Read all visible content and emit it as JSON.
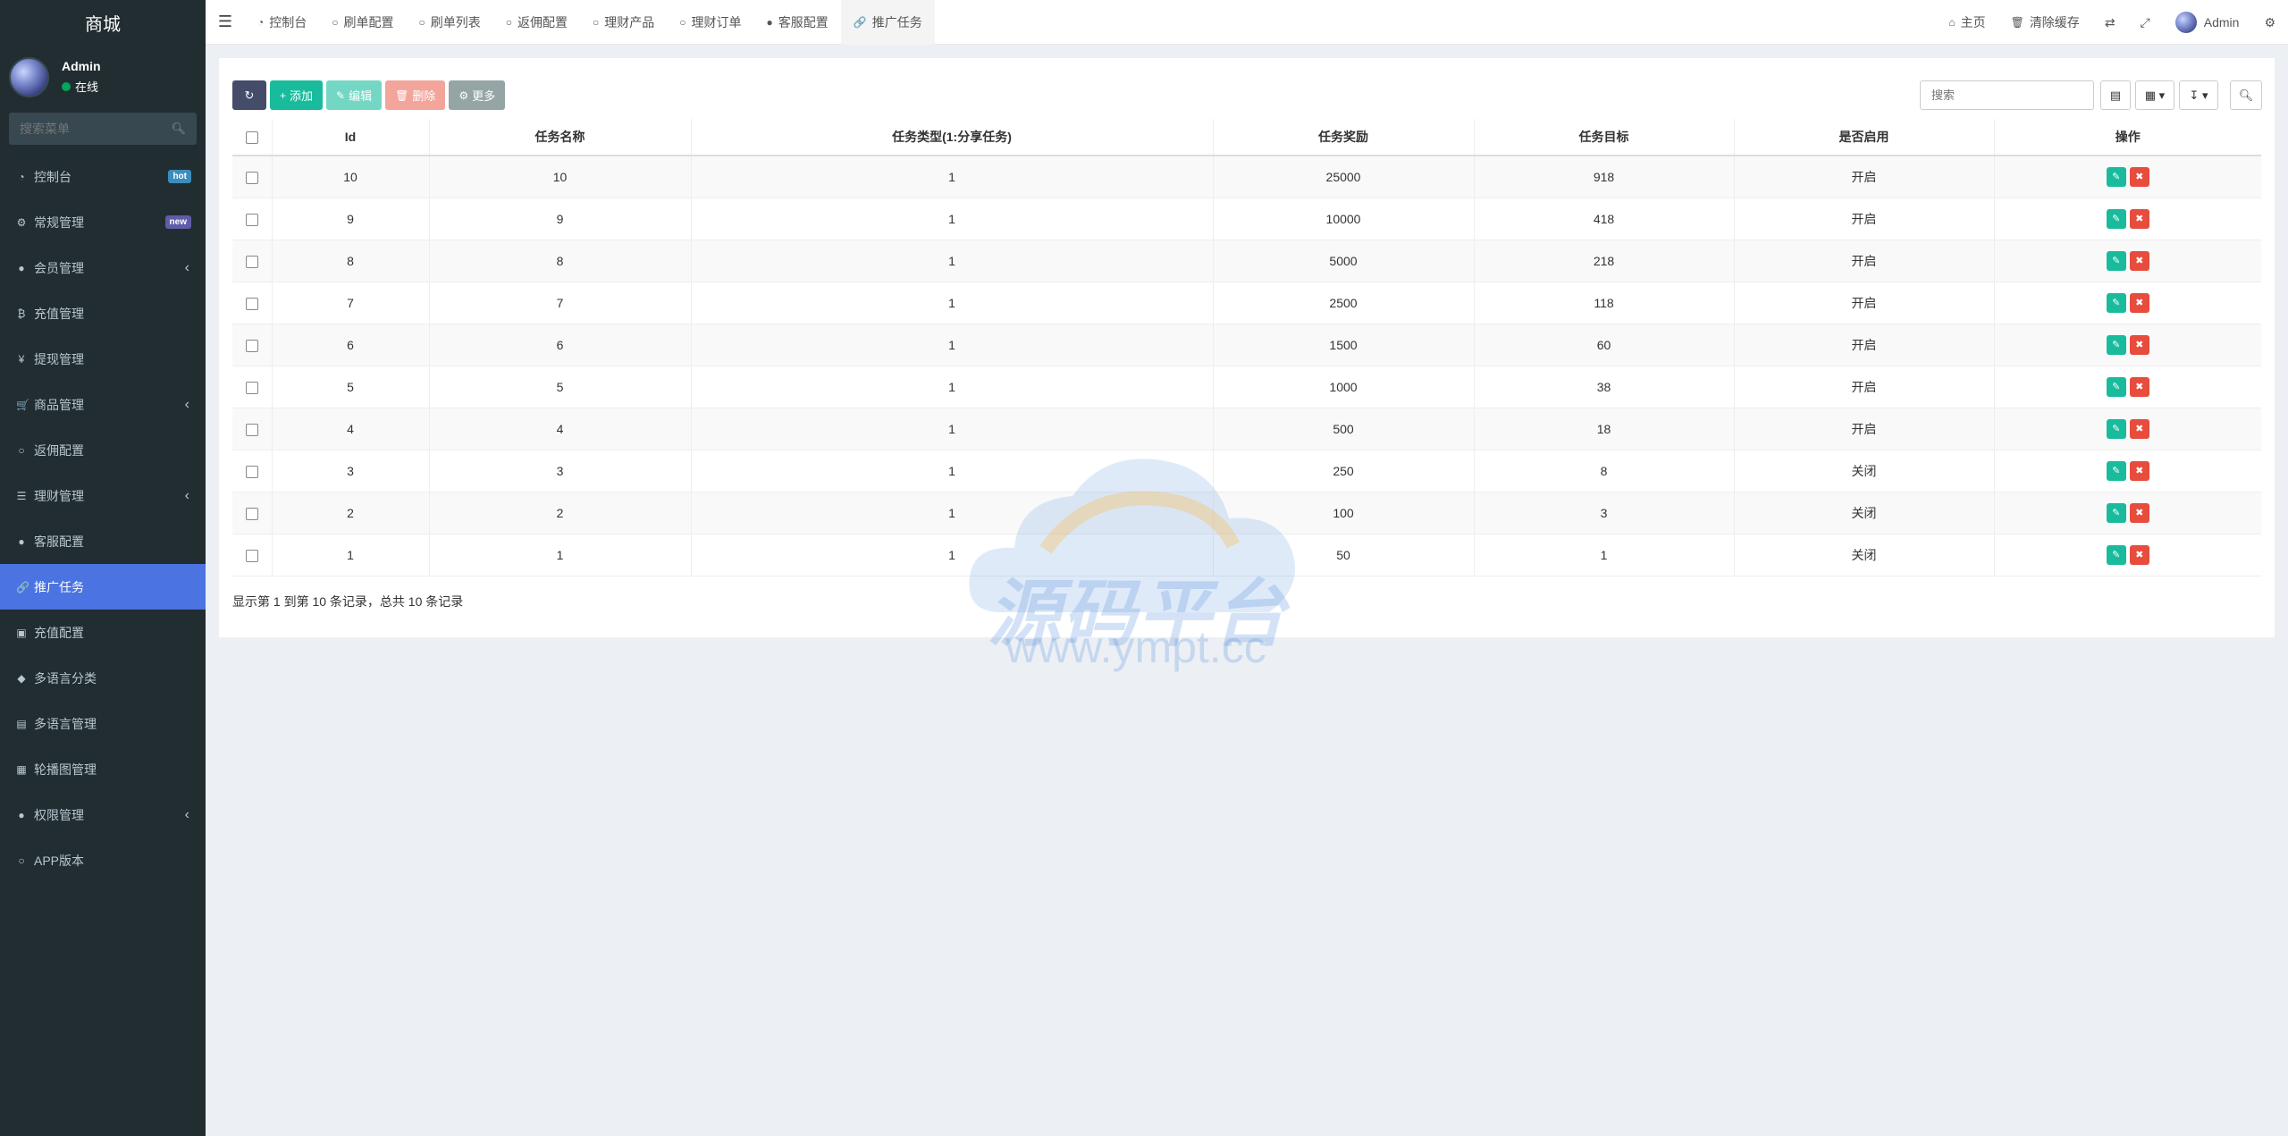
{
  "app": {
    "logo": "商城",
    "user": {
      "name": "Admin",
      "status": "在线"
    },
    "sidebar_search_placeholder": "搜索菜单"
  },
  "sidebar": {
    "items": [
      {
        "label": "控制台",
        "icon": "dashboard-icon",
        "glyph": "◔",
        "badge": "hot"
      },
      {
        "label": "常规管理",
        "icon": "cogs-icon",
        "glyph": "⚙",
        "badge": "new"
      },
      {
        "label": "会员管理",
        "icon": "user-circle-icon",
        "glyph": "●",
        "arrow": "‹"
      },
      {
        "label": "充值管理",
        "icon": "bitcoin-icon",
        "glyph": "₿"
      },
      {
        "label": "提现管理",
        "icon": "yen-icon",
        "glyph": "¥"
      },
      {
        "label": "商品管理",
        "icon": "cart-icon",
        "glyph": "🛒",
        "arrow": "‹"
      },
      {
        "label": "返佣配置",
        "icon": "circle-icon",
        "glyph": "○"
      },
      {
        "label": "理财管理",
        "icon": "list-icon",
        "glyph": "☰",
        "arrow": "‹"
      },
      {
        "label": "客服配置",
        "icon": "check-circle-icon",
        "glyph": "●"
      },
      {
        "label": "推广任务",
        "icon": "link-icon",
        "glyph": "🔗",
        "active": true
      },
      {
        "label": "充值配置",
        "icon": "image-icon",
        "glyph": "▣"
      },
      {
        "label": "多语言分类",
        "icon": "tag-icon",
        "glyph": "◆"
      },
      {
        "label": "多语言管理",
        "icon": "language-icon",
        "glyph": "▤"
      },
      {
        "label": "轮播图管理",
        "icon": "file-image-icon",
        "glyph": "▦"
      },
      {
        "label": "权限管理",
        "icon": "users-icon",
        "glyph": "●",
        "arrow": "‹"
      },
      {
        "label": "APP版本",
        "icon": "circle-icon",
        "glyph": "○"
      }
    ]
  },
  "topbar": {
    "tabs": [
      {
        "label": "控制台",
        "icon": "dashboard-icon",
        "glyph": "◔"
      },
      {
        "label": "刷单配置",
        "icon": "circle-icon",
        "glyph": "○"
      },
      {
        "label": "刷单列表",
        "icon": "circle-icon",
        "glyph": "○"
      },
      {
        "label": "返佣配置",
        "icon": "circle-icon",
        "glyph": "○"
      },
      {
        "label": "理财产品",
        "icon": "circle-icon",
        "glyph": "○"
      },
      {
        "label": "理财订单",
        "icon": "circle-icon",
        "glyph": "○"
      },
      {
        "label": "客服配置",
        "icon": "check-circle-icon",
        "glyph": "●"
      },
      {
        "label": "推广任务",
        "icon": "link-icon",
        "glyph": "🔗",
        "active": true
      }
    ],
    "home": "主页",
    "clear_cache": "清除缓存",
    "admin": "Admin"
  },
  "toolbar": {
    "add": "添加",
    "edit": "编辑",
    "delete": "删除",
    "more": "更多",
    "search_placeholder": "搜索"
  },
  "table": {
    "headers": [
      "Id",
      "任务名称",
      "任务类型(1:分享任务)",
      "任务奖励",
      "任务目标",
      "是否启用",
      "操作"
    ],
    "rows": [
      {
        "id": "10",
        "name": "10",
        "type": "1",
        "reward": "25000",
        "target": "918",
        "enabled": "开启"
      },
      {
        "id": "9",
        "name": "9",
        "type": "1",
        "reward": "10000",
        "target": "418",
        "enabled": "开启"
      },
      {
        "id": "8",
        "name": "8",
        "type": "1",
        "reward": "5000",
        "target": "218",
        "enabled": "开启"
      },
      {
        "id": "7",
        "name": "7",
        "type": "1",
        "reward": "2500",
        "target": "118",
        "enabled": "开启"
      },
      {
        "id": "6",
        "name": "6",
        "type": "1",
        "reward": "1500",
        "target": "60",
        "enabled": "开启"
      },
      {
        "id": "5",
        "name": "5",
        "type": "1",
        "reward": "1000",
        "target": "38",
        "enabled": "开启"
      },
      {
        "id": "4",
        "name": "4",
        "type": "1",
        "reward": "500",
        "target": "18",
        "enabled": "开启"
      },
      {
        "id": "3",
        "name": "3",
        "type": "1",
        "reward": "250",
        "target": "8",
        "enabled": "关闭"
      },
      {
        "id": "2",
        "name": "2",
        "type": "1",
        "reward": "100",
        "target": "3",
        "enabled": "关闭"
      },
      {
        "id": "1",
        "name": "1",
        "type": "1",
        "reward": "50",
        "target": "1",
        "enabled": "关闭"
      }
    ]
  },
  "pagination": {
    "info": "显示第 1 到第 10 条记录，总共 10 条记录"
  },
  "watermark": {
    "text": "源码平台",
    "url": "www.ympt.cc"
  }
}
